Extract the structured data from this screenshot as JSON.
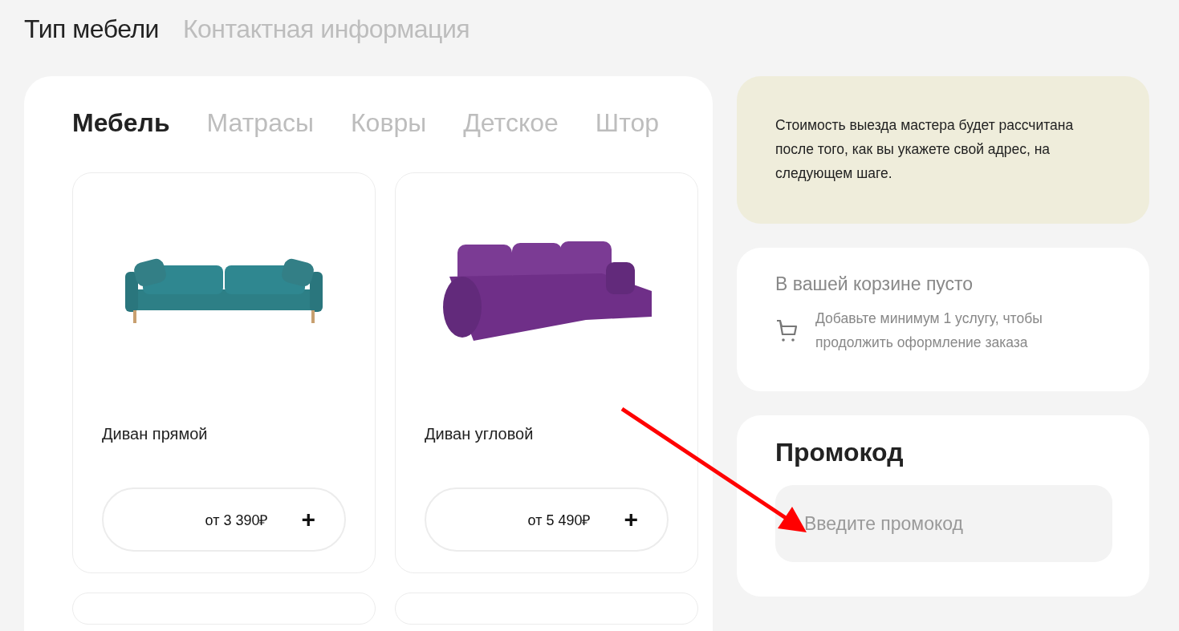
{
  "steps": [
    {
      "label": "Тип мебели",
      "selected": true
    },
    {
      "label": "Контактная информация",
      "selected": false
    }
  ],
  "categories": [
    {
      "label": "Мебель",
      "selected": true
    },
    {
      "label": "Матрасы",
      "selected": false
    },
    {
      "label": "Ковры",
      "selected": false
    },
    {
      "label": "Детское",
      "selected": false
    },
    {
      "label": "Штор",
      "selected": false
    }
  ],
  "products": [
    {
      "name": "Диван прямой",
      "price": "от 3 390₽",
      "add": "+",
      "kind": "straight"
    },
    {
      "name": "Диван угловой",
      "price": "от 5 490₽",
      "add": "+",
      "kind": "corner"
    }
  ],
  "notice": "Стоимость выезда мастера будет рассчитана после того, как вы укажете свой адрес, на следующем шаге.",
  "cart": {
    "title": "В вашей корзине пусто",
    "message": "Добавьте минимум 1 услугу, чтобы продолжить оформление заказа"
  },
  "promo": {
    "title": "Промокод",
    "placeholder": "Введите промокод"
  }
}
